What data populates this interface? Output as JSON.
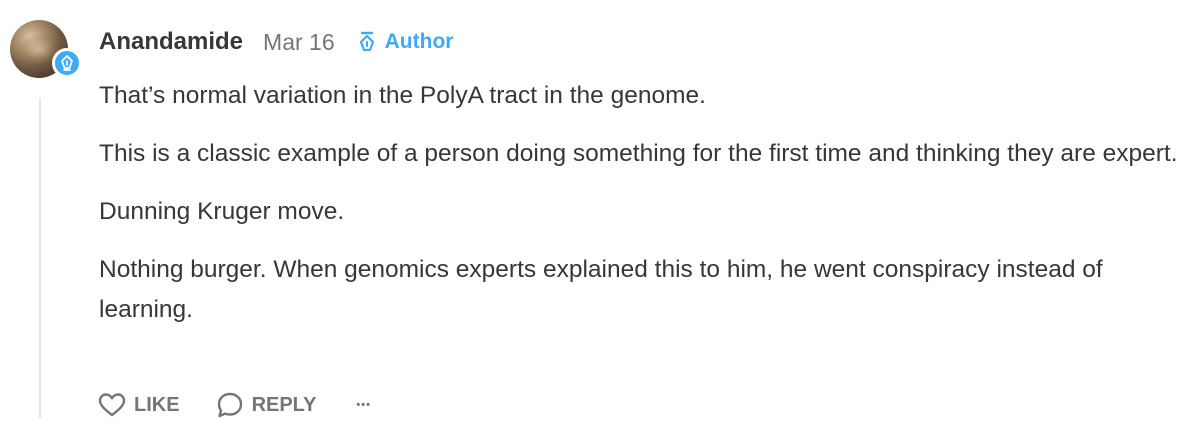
{
  "comment": {
    "author": {
      "name": "Anandamide",
      "avatar_icon": "user-avatar",
      "badge_icon": "pen-nib-icon"
    },
    "date": "Mar 16",
    "author_tag": {
      "label": "Author",
      "icon": "pen-nib-icon",
      "color": "#3fa9f5"
    },
    "paragraphs": [
      "That’s normal variation in the PolyA tract in the genome.",
      "This is a classic example of a person doing something for the first time and thinking they are expert.",
      "Dunning Kruger move.",
      "Nothing burger. When genomics experts explained this to him, he went conspiracy instead of learning."
    ],
    "actions": {
      "like_label": "LIKE",
      "reply_label": "REPLY",
      "more_label": "•••"
    }
  }
}
